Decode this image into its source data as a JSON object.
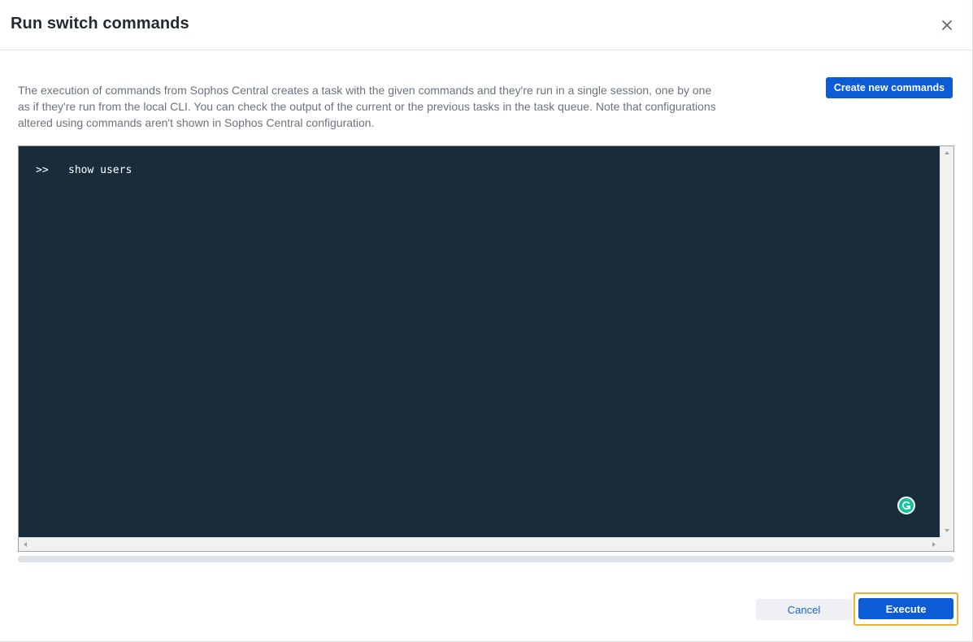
{
  "dialog": {
    "title": "Run switch commands",
    "close_icon": "close-icon"
  },
  "description": "The execution of commands from Sophos Central creates a task with the given commands and they're run in a single session, one by one as if they're run from the local CLI. You can check the output of the current or the previous tasks in the task queue. Note that configurations altered using commands aren't shown in Sophos Central configuration.",
  "toolbar": {
    "create_label": "Create new commands"
  },
  "terminal": {
    "prompt": ">>",
    "command": "show users",
    "background_color": "#182c3b",
    "grammarly_icon": "grammarly-icon"
  },
  "footer": {
    "cancel_label": "Cancel",
    "execute_label": "Execute",
    "accent_color": "#0b5cd5",
    "highlight_color": "#f2b033"
  }
}
